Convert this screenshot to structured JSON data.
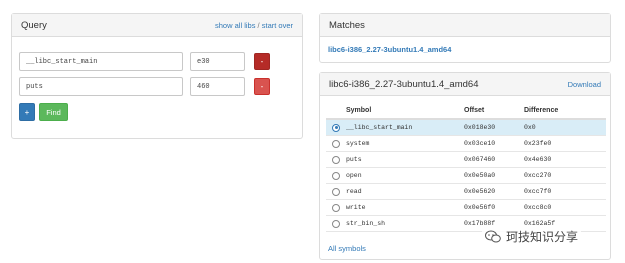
{
  "query": {
    "title": "Query",
    "show_all_libs": "show all libs",
    "separator": "/",
    "start_over": "start over",
    "rows": [
      {
        "name": "__libc_start_main",
        "addr": "e30",
        "remove_label": "-"
      },
      {
        "name": "puts",
        "addr": "460",
        "remove_label": "-"
      }
    ],
    "add_label": "+",
    "find_label": "Find"
  },
  "matches": {
    "title": "Matches",
    "items": [
      "libc6-i386_2.27-3ubuntu1.4_amd64"
    ]
  },
  "detail": {
    "title": "libc6-i386_2.27-3ubuntu1.4_amd64",
    "download": "Download",
    "headers": [
      "Symbol",
      "Offset",
      "Difference"
    ],
    "rows": [
      {
        "symbol": "__libc_start_main",
        "offset": "0x018e30",
        "diff": "0x0",
        "selected": true
      },
      {
        "symbol": "system",
        "offset": "0x03ce10",
        "diff": "0x23fe0",
        "selected": false
      },
      {
        "symbol": "puts",
        "offset": "0x067460",
        "diff": "0x4e630",
        "selected": false
      },
      {
        "symbol": "open",
        "offset": "0x0e50a0",
        "diff": "0xcc270",
        "selected": false
      },
      {
        "symbol": "read",
        "offset": "0x0e5620",
        "diff": "0xcc7f0",
        "selected": false
      },
      {
        "symbol": "write",
        "offset": "0x0e56f0",
        "diff": "0xcc8c0",
        "selected": false
      },
      {
        "symbol": "str_bin_sh",
        "offset": "0x17b88f",
        "diff": "0x162a5f",
        "selected": false
      }
    ],
    "all_symbols": "All symbols"
  },
  "watermark": {
    "text": "珂技知识分享",
    "icon": "wechat-icon"
  }
}
